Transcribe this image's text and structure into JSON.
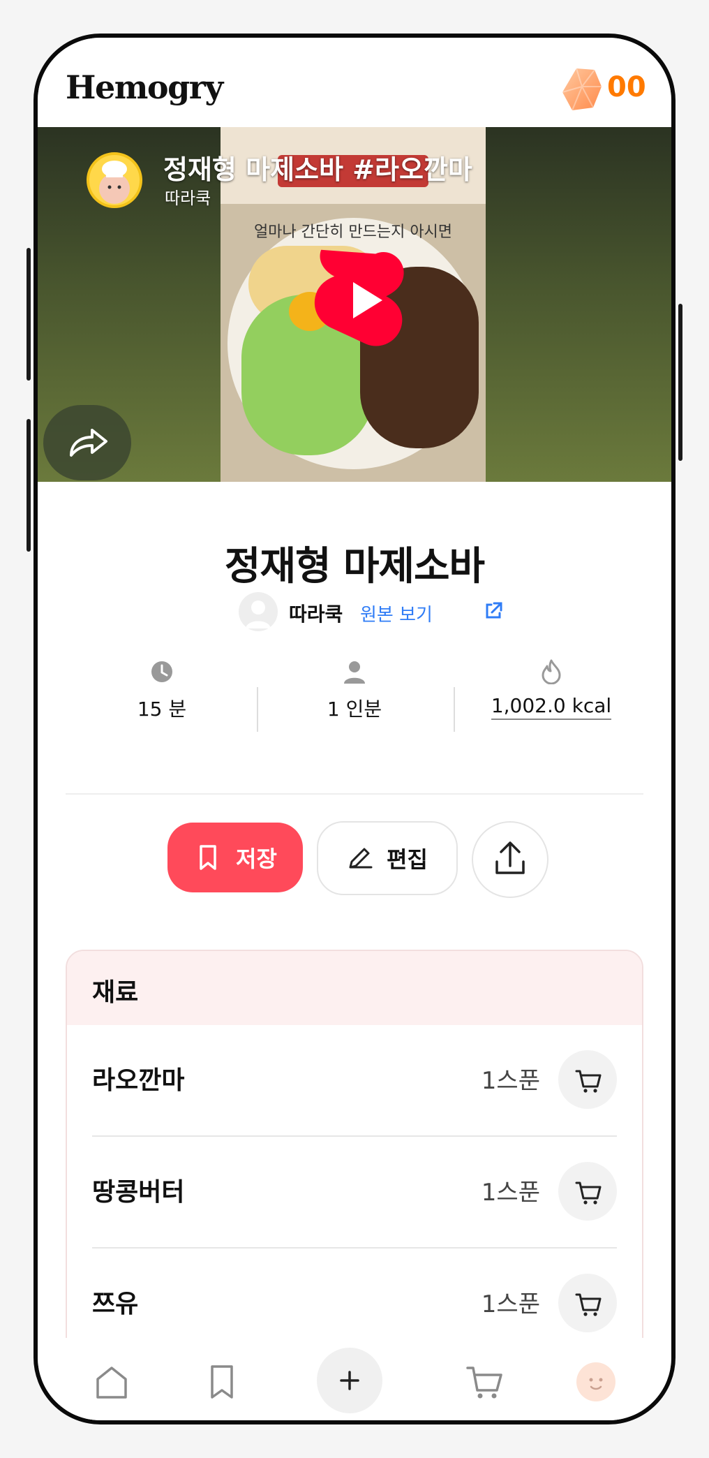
{
  "app": {
    "logo_text": "Hemogry",
    "points": "00"
  },
  "video": {
    "title": "정재형 마제소바 #라오깐마",
    "channel": "따라쿡",
    "thumbnail_caption": "얼마나 간단히 만드는지 아시면"
  },
  "recipe": {
    "title": "정재형 마제소바",
    "author": "따라쿡",
    "original_link_label": "원본 보기",
    "stats": {
      "time": "15 분",
      "servings": "1 인분",
      "calories": "1,002.0 kcal"
    }
  },
  "actions": {
    "save_label": "저장",
    "edit_label": "편집"
  },
  "ingredients": {
    "title": "재료",
    "items": [
      {
        "name": "라오깐마",
        "amount": "1스푼"
      },
      {
        "name": "땅콩버터",
        "amount": "1스푼"
      },
      {
        "name": "쯔유",
        "amount": "1스푼"
      }
    ]
  },
  "colors": {
    "accent": "#ff4a5a",
    "points": "#ff7a00",
    "link": "#2f7cf6",
    "ingredient_header_bg": "#fdf0f0"
  },
  "icons": {
    "header": "gem-icon",
    "video": [
      "youtube-shorts-icon",
      "share-arrow-icon"
    ],
    "stats": [
      "clock-icon",
      "person-icon",
      "flame-icon"
    ],
    "actions": [
      "bookmark-icon",
      "pencil-icon",
      "upload-icon"
    ],
    "ingredients": "cart-icon",
    "tabbar": [
      "home-icon",
      "bookmark-icon",
      "plus-icon",
      "cart-icon",
      "profile-avatar"
    ]
  }
}
